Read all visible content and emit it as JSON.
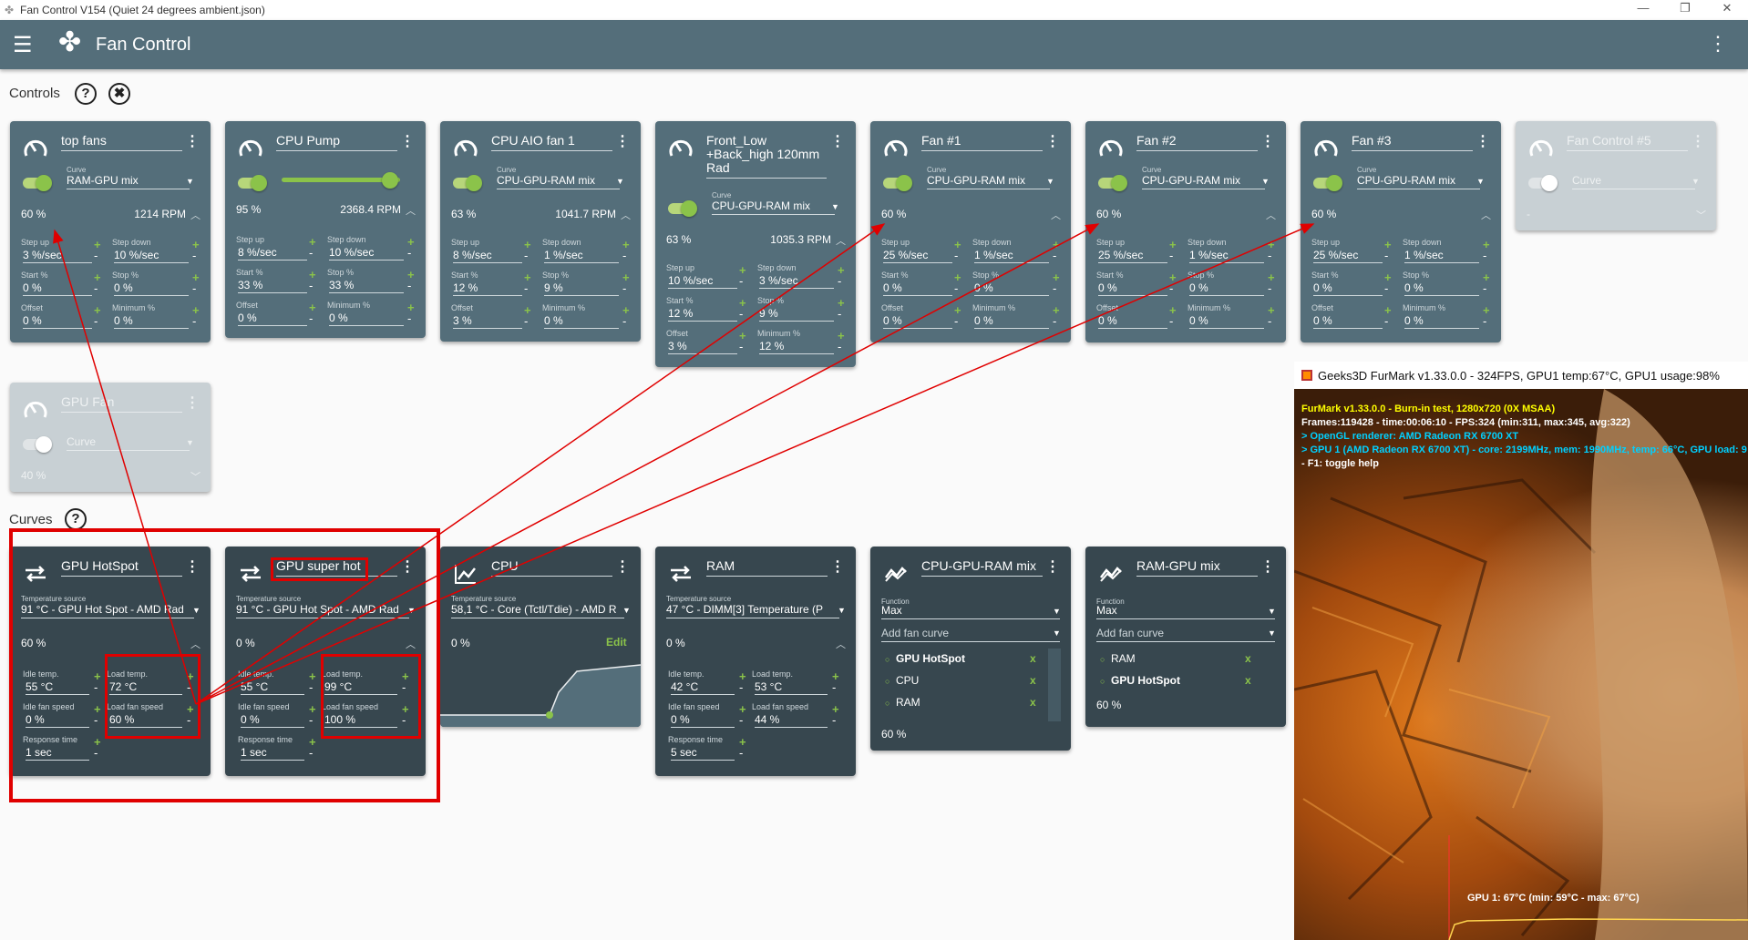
{
  "window": {
    "title": "Fan Control V154 (Quiet 24 degrees ambient.json)",
    "minimize": "—",
    "maximize": "❐",
    "close": "✕"
  },
  "appbar": {
    "title": "Fan Control",
    "menu_icon": "☰",
    "logo_icon": "✤",
    "more_icon": "⋮"
  },
  "sections": {
    "controls": "Controls",
    "curves": "Curves",
    "help": "?",
    "tools": "✖"
  },
  "controls": [
    {
      "name": "top fans",
      "enabled": true,
      "curve_label": "Curve",
      "curve": "RAM-GPU mix",
      "percent": "60 %",
      "rpm": "1214 RPM",
      "fields": [
        [
          "Step up",
          "3 %/sec"
        ],
        [
          "Step down",
          "10 %/sec"
        ],
        [
          "Start %",
          "0 %"
        ],
        [
          "Stop %",
          "0 %"
        ],
        [
          "Offset",
          "0 %"
        ],
        [
          "Minimum %",
          "0 %"
        ]
      ]
    },
    {
      "name": "CPU Pump",
      "enabled": true,
      "curve_label": "",
      "curve": "",
      "percent": "95 %",
      "rpm": "2368.4 RPM",
      "fields": [
        [
          "Step up",
          "8 %/sec"
        ],
        [
          "Step down",
          "10 %/sec"
        ],
        [
          "Start %",
          "33 %"
        ],
        [
          "Stop %",
          "33 %"
        ],
        [
          "Offset",
          "0 %"
        ],
        [
          "Minimum %",
          "0 %"
        ]
      ]
    },
    {
      "name": "CPU AIO fan 1",
      "enabled": true,
      "curve_label": "Curve",
      "curve": "CPU-GPU-RAM mix",
      "percent": "63 %",
      "rpm": "1041.7 RPM",
      "fields": [
        [
          "Step up",
          "8 %/sec"
        ],
        [
          "Step down",
          "1 %/sec"
        ],
        [
          "Start %",
          "12 %"
        ],
        [
          "Stop %",
          "9 %"
        ],
        [
          "Offset",
          "3 %"
        ],
        [
          "Minimum %",
          "0 %"
        ]
      ]
    },
    {
      "name": "Front_Low +Back_high 120mm Rad",
      "enabled": true,
      "curve_label": "Curve",
      "curve": "CPU-GPU-RAM mix",
      "percent": "63 %",
      "rpm": "1035.3 RPM",
      "fields": [
        [
          "Step up",
          "10 %/sec"
        ],
        [
          "Step down",
          "3 %/sec"
        ],
        [
          "Start %",
          "12 %"
        ],
        [
          "Stop %",
          "9 %"
        ],
        [
          "Offset",
          "3 %"
        ],
        [
          "Minimum %",
          "12 %"
        ]
      ]
    },
    {
      "name": "Fan #1",
      "enabled": true,
      "curve_label": "Curve",
      "curve": "CPU-GPU-RAM mix",
      "percent": "60 %",
      "rpm": "",
      "fields": [
        [
          "Step up",
          "25 %/sec"
        ],
        [
          "Step down",
          "1 %/sec"
        ],
        [
          "Start %",
          "0 %"
        ],
        [
          "Stop %",
          "0 %"
        ],
        [
          "Offset",
          "0 %"
        ],
        [
          "Minimum %",
          "0 %"
        ]
      ]
    },
    {
      "name": "Fan #2",
      "enabled": true,
      "curve_label": "Curve",
      "curve": "CPU-GPU-RAM mix",
      "percent": "60 %",
      "rpm": "",
      "fields": [
        [
          "Step up",
          "25 %/sec"
        ],
        [
          "Step down",
          "1 %/sec"
        ],
        [
          "Start %",
          "0 %"
        ],
        [
          "Stop %",
          "0 %"
        ],
        [
          "Offset",
          "0 %"
        ],
        [
          "Minimum %",
          "0 %"
        ]
      ]
    },
    {
      "name": "Fan #3",
      "enabled": true,
      "curve_label": "Curve",
      "curve": "CPU-GPU-RAM mix",
      "percent": "60 %",
      "rpm": "",
      "fields": [
        [
          "Step up",
          "25 %/sec"
        ],
        [
          "Step down",
          "1 %/sec"
        ],
        [
          "Start %",
          "0 %"
        ],
        [
          "Stop %",
          "0 %"
        ],
        [
          "Offset",
          "0 %"
        ],
        [
          "Minimum %",
          "0 %"
        ]
      ]
    },
    {
      "name": "Fan Control #5",
      "enabled": false,
      "curve_label": "",
      "curve": "Curve",
      "percent": "-",
      "rpm": "",
      "fields": []
    },
    {
      "name": "GPU Fan",
      "enabled": false,
      "curve_label": "",
      "curve": "Curve",
      "percent": "40 %",
      "rpm": "",
      "fields": []
    }
  ],
  "curves": [
    {
      "name": "GPU HotSpot",
      "src_label": "Temperature source",
      "source": "91 °C - GPU Hot Spot - AMD Rad",
      "percent": "60 %",
      "fields": [
        [
          "Idle temp.",
          "55 °C"
        ],
        [
          "Load temp.",
          "72 °C"
        ],
        [
          "Idle fan speed",
          "0 %"
        ],
        [
          "Load fan speed",
          "60 %"
        ],
        [
          "Response time",
          "1 sec"
        ]
      ]
    },
    {
      "name": "GPU super hot",
      "src_label": "Temperature source",
      "source": "91 °C - GPU Hot Spot - AMD Rad",
      "percent": "0 %",
      "fields": [
        [
          "Idle temp.",
          "55 °C"
        ],
        [
          "Load temp.",
          "99 °C"
        ],
        [
          "Idle fan speed",
          "0 %"
        ],
        [
          "Load fan speed",
          "100 %"
        ],
        [
          "Response time",
          "1 sec"
        ]
      ]
    },
    {
      "name": "CPU",
      "src_label": "Temperature source",
      "source": "58,1 °C - Core (Tctl/Tdie) - AMD R",
      "percent": "0 %",
      "edit": "Edit"
    },
    {
      "name": "RAM",
      "src_label": "Temperature source",
      "source": "47 °C - DIMM[3] Temperature (P",
      "percent": "0 %",
      "fields": [
        [
          "Idle temp.",
          "42 °C"
        ],
        [
          "Load temp.",
          "53 °C"
        ],
        [
          "Idle fan speed",
          "0 %"
        ],
        [
          "Load fan speed",
          "44 %"
        ],
        [
          "Response time",
          "5 sec"
        ]
      ]
    },
    {
      "name": "CPU-GPU-RAM mix",
      "fn_label": "Function",
      "function": "Max",
      "add": "Add fan curve",
      "items": [
        "GPU HotSpot",
        "CPU",
        "RAM"
      ],
      "percent": "60 %"
    },
    {
      "name": "RAM-GPU mix",
      "fn_label": "Function",
      "function": "Max",
      "add": "Add fan curve",
      "items": [
        "RAM",
        "GPU HotSpot"
      ],
      "percent": "60 %"
    }
  ],
  "furmark": {
    "title": "Geeks3D FurMark v1.33.0.0 - 324FPS, GPU1 temp:67°C, GPU1 usage:98%",
    "lines": [
      "FurMark v1.33.0.0 - Burn-in test, 1280x720 (0X MSAA)",
      "Frames:119428 - time:00:06:10 - FPS:324 (min:311, max:345, avg:322)",
      "> OpenGL renderer: AMD Radeon RX 6700 XT",
      "> GPU 1 (AMD Radeon RX 6700 XT) - core: 2199MHz, mem: 1990MHz, temp: 66°C, GPU load: 9",
      "- F1: toggle help"
    ],
    "graph_label": "GPU 1: 67°C (min: 59°C - max: 67°C)",
    "colors": {
      "title": "#ffff00",
      "info": "#ffffff",
      "renderer": "#00d0ff"
    }
  },
  "colors": {
    "accent": "#8bc34a",
    "card": "#546e7a",
    "card_dark": "#37474f",
    "highlight": "#e00000"
  }
}
